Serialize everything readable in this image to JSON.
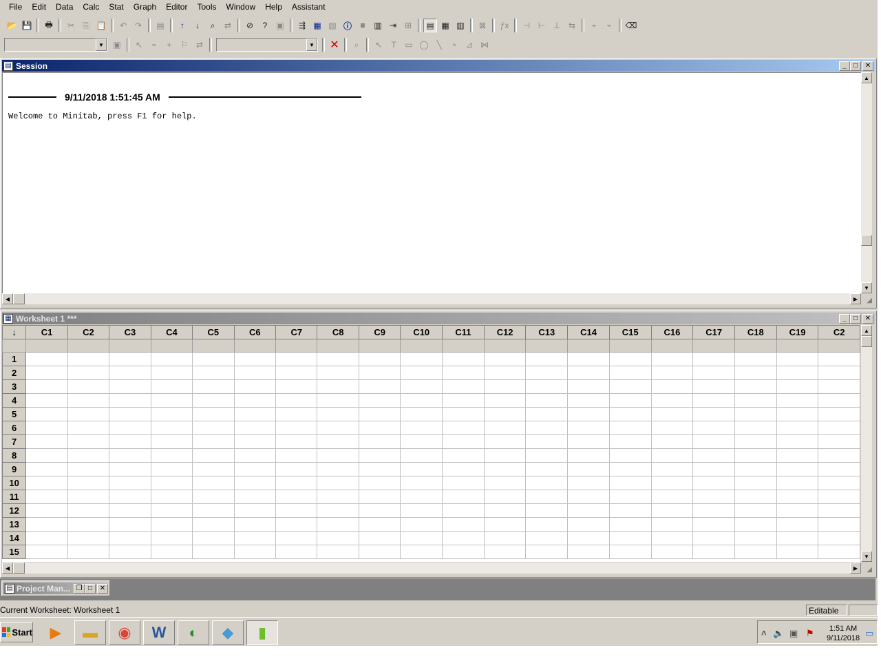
{
  "menu": [
    "File",
    "Edit",
    "Data",
    "Calc",
    "Stat",
    "Graph",
    "Editor",
    "Tools",
    "Window",
    "Help",
    "Assistant"
  ],
  "toolbar1": {
    "icons": [
      "open-icon",
      "save-icon",
      "print-icon",
      "cut-icon",
      "copy-icon",
      "paste-icon",
      "undo-icon",
      "redo-icon",
      "edit-last-dialog-icon",
      "prev-brushed-icon",
      "next-brushed-icon",
      "find-icon",
      "replace-icon",
      "cancel-command-icon",
      "help-icon",
      "stat-guide-icon",
      "session-window-icon",
      "worksheets-icon",
      "graphs-icon",
      "info-icon",
      "history-icon",
      "report-pad-icon",
      "related-docs-icon",
      "design-icon",
      "show-session-icon",
      "show-worksheet-icon",
      "show-graphs-icon",
      "close-all-graphs-icon",
      "formula-icon",
      "insert-cells-icon",
      "insert-rows-icon",
      "insert-columns-icon",
      "move-columns-icon",
      "brush-icon",
      "set-id-icon",
      "eraser-icon"
    ]
  },
  "toolbar2": {
    "combo1_value": "",
    "combo2_value": ""
  },
  "session": {
    "title": "Session",
    "timestamp": "9/11/2018 1:51:45 AM",
    "welcome": "Welcome to Minitab, press F1 for help."
  },
  "worksheet": {
    "title": "Worksheet 1 ***",
    "corner": "↓",
    "columns": [
      "C1",
      "C2",
      "C3",
      "C4",
      "C5",
      "C6",
      "C7",
      "C8",
      "C9",
      "C10",
      "C11",
      "C12",
      "C13",
      "C14",
      "C15",
      "C16",
      "C17",
      "C18",
      "C19",
      "C2"
    ],
    "rows": [
      "1",
      "2",
      "3",
      "4",
      "5",
      "6",
      "7",
      "8",
      "9",
      "10",
      "11",
      "12",
      "13",
      "14",
      "15"
    ]
  },
  "project_manager": {
    "title": "Project Man..."
  },
  "status": {
    "text": "Current Worksheet: Worksheet 1",
    "mode": "Editable"
  },
  "taskbar": {
    "start_label": "Start",
    "apps": [
      "media-player-icon",
      "file-explorer-icon",
      "chrome-icon",
      "word-icon",
      "internet-download-icon",
      "notepad-icon",
      "minitab-icon"
    ],
    "clock_time": "1:51 AM",
    "clock_date": "9/11/2018"
  }
}
